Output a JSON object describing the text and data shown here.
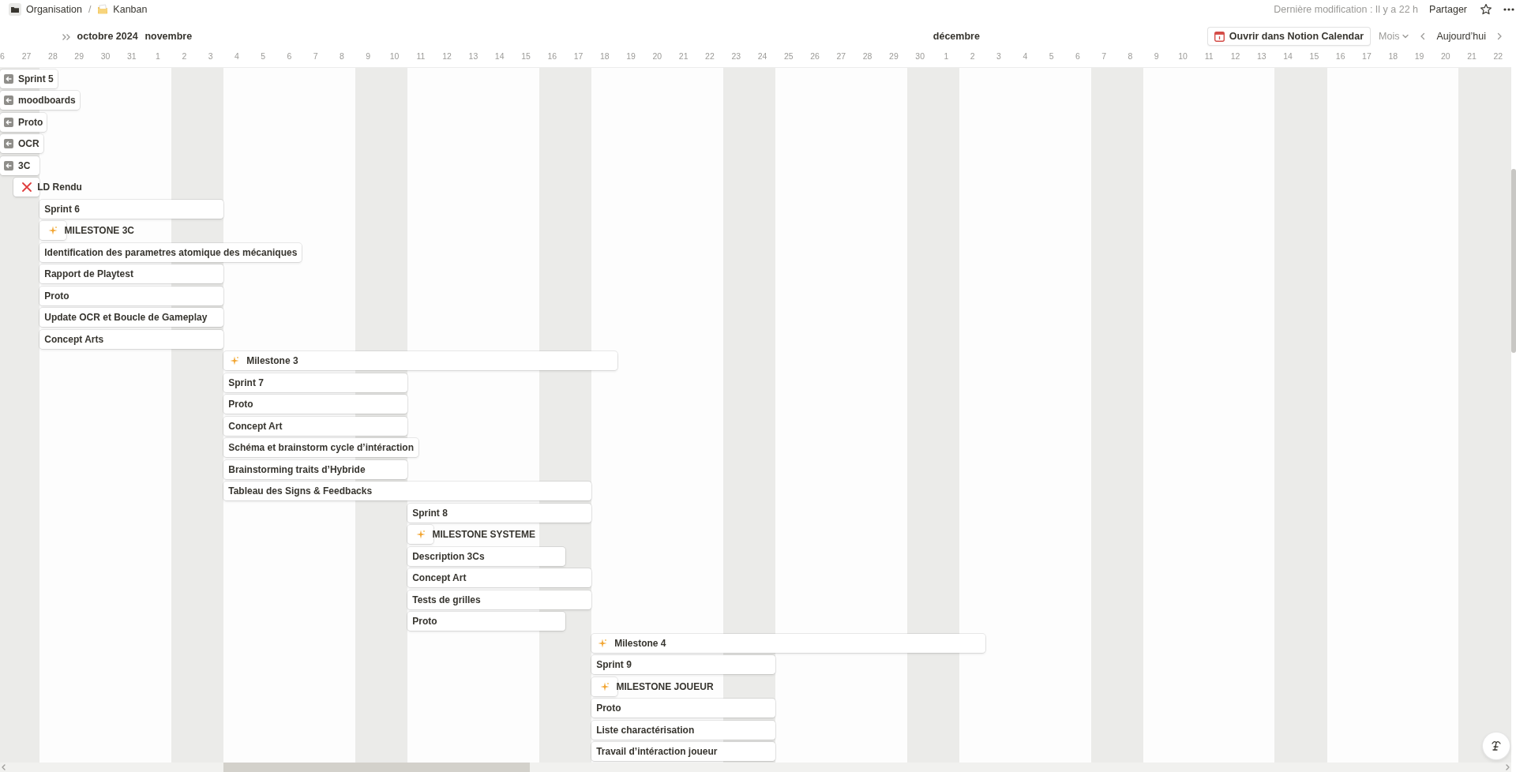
{
  "breadcrumb": {
    "items": [
      {
        "label": "Organisation"
      },
      {
        "label": "Kanban"
      }
    ],
    "separator": "/"
  },
  "header_right": {
    "last_edited": "Dernière modification : Il y a 22 h",
    "share": "Partager"
  },
  "toolbar": {
    "calendar_button": "Ouvrir dans Notion Calendar",
    "view": "Mois",
    "today": "Aujourd’hui"
  },
  "months": [
    {
      "label": "octobre 2024",
      "kind": "sticky"
    },
    {
      "label": "novembre",
      "kind": "month"
    },
    {
      "label": "décembre",
      "kind": "month"
    }
  ],
  "days": [
    {
      "label": "6",
      "weekend": true
    },
    {
      "label": "27",
      "weekend": true
    },
    {
      "label": "28",
      "weekend": false
    },
    {
      "label": "29",
      "weekend": false
    },
    {
      "label": "30",
      "weekend": false
    },
    {
      "label": "31",
      "weekend": false
    },
    {
      "label": "1",
      "weekend": false
    },
    {
      "label": "2",
      "weekend": true
    },
    {
      "label": "3",
      "weekend": true
    },
    {
      "label": "4",
      "weekend": false
    },
    {
      "label": "5",
      "weekend": false
    },
    {
      "label": "6",
      "weekend": false
    },
    {
      "label": "7",
      "weekend": false
    },
    {
      "label": "8",
      "weekend": false
    },
    {
      "label": "9",
      "weekend": true
    },
    {
      "label": "10",
      "weekend": true
    },
    {
      "label": "11",
      "weekend": false
    },
    {
      "label": "12",
      "weekend": false
    },
    {
      "label": "13",
      "weekend": false
    },
    {
      "label": "14",
      "weekend": false
    },
    {
      "label": "15",
      "weekend": false
    },
    {
      "label": "16",
      "weekend": true
    },
    {
      "label": "17",
      "weekend": true
    },
    {
      "label": "18",
      "weekend": false
    },
    {
      "label": "19",
      "weekend": false
    },
    {
      "label": "20",
      "weekend": false
    },
    {
      "label": "21",
      "weekend": false
    },
    {
      "label": "22",
      "weekend": false
    },
    {
      "label": "23",
      "weekend": true
    },
    {
      "label": "24",
      "weekend": true
    },
    {
      "label": "25",
      "weekend": false
    },
    {
      "label": "26",
      "weekend": false
    },
    {
      "label": "27",
      "weekend": false
    },
    {
      "label": "28",
      "weekend": false
    },
    {
      "label": "29",
      "weekend": false
    },
    {
      "label": "30",
      "weekend": true
    },
    {
      "label": "1",
      "weekend": true
    },
    {
      "label": "2",
      "weekend": false
    },
    {
      "label": "3",
      "weekend": false
    },
    {
      "label": "4",
      "weekend": false
    },
    {
      "label": "5",
      "weekend": false
    },
    {
      "label": "6",
      "weekend": false
    },
    {
      "label": "7",
      "weekend": true
    },
    {
      "label": "8",
      "weekend": true
    },
    {
      "label": "9",
      "weekend": false
    },
    {
      "label": "10",
      "weekend": false
    },
    {
      "label": "11",
      "weekend": false
    },
    {
      "label": "12",
      "weekend": false
    },
    {
      "label": "13",
      "weekend": false
    },
    {
      "label": "14",
      "weekend": true
    },
    {
      "label": "15",
      "weekend": true
    },
    {
      "label": "16",
      "weekend": false
    },
    {
      "label": "17",
      "weekend": false
    },
    {
      "label": "18",
      "weekend": false
    },
    {
      "label": "19",
      "weekend": false
    },
    {
      "label": "20",
      "weekend": false
    },
    {
      "label": "21",
      "weekend": true
    },
    {
      "label": "22",
      "weekend": true
    }
  ],
  "items": [
    {
      "kind": "offscreen",
      "label": "Sprint 5"
    },
    {
      "kind": "offscreen",
      "label": "moodboards"
    },
    {
      "kind": "offscreen",
      "label": "Proto"
    },
    {
      "kind": "offscreen",
      "label": "OCR"
    },
    {
      "kind": "offscreen",
      "label": "3C"
    },
    {
      "kind": "cancelled_point",
      "label": "LD Rendu"
    },
    {
      "kind": "task",
      "label": "Sprint 6"
    },
    {
      "kind": "milestone_point",
      "label": "MILESTONE 3C"
    },
    {
      "kind": "task",
      "label": "Identification des parametres atomique des mécaniques"
    },
    {
      "kind": "task",
      "label": "Rapport de Playtest"
    },
    {
      "kind": "task",
      "label": "Proto"
    },
    {
      "kind": "task",
      "label": "Update OCR et Boucle de Gameplay"
    },
    {
      "kind": "task",
      "label": "Concept Arts"
    },
    {
      "kind": "milestone",
      "label": "Milestone 3"
    },
    {
      "kind": "task",
      "label": "Sprint 7"
    },
    {
      "kind": "task",
      "label": "Proto"
    },
    {
      "kind": "task",
      "label": "Concept Art"
    },
    {
      "kind": "task",
      "label": "Schéma et brainstorm cycle d’intéraction"
    },
    {
      "kind": "task",
      "label": "Brainstorming traits d’Hybride"
    },
    {
      "kind": "task",
      "label": "Tableau des Signs & Feedbacks"
    },
    {
      "kind": "task",
      "label": "Sprint 8"
    },
    {
      "kind": "milestone_point",
      "label": "MILESTONE SYSTEME"
    },
    {
      "kind": "task",
      "label": "Description 3Cs"
    },
    {
      "kind": "task",
      "label": "Concept Art"
    },
    {
      "kind": "task",
      "label": "Tests de grilles"
    },
    {
      "kind": "task",
      "label": "Proto"
    },
    {
      "kind": "milestone",
      "label": "Milestone 4"
    },
    {
      "kind": "task",
      "label": "Sprint 9"
    },
    {
      "kind": "milestone_point",
      "label": "MILESTONE JOUEUR"
    },
    {
      "kind": "task",
      "label": "Proto"
    },
    {
      "kind": "task",
      "label": "Liste charactérisation"
    },
    {
      "kind": "task",
      "label": "Travail d’intéraction joueur"
    }
  ]
}
